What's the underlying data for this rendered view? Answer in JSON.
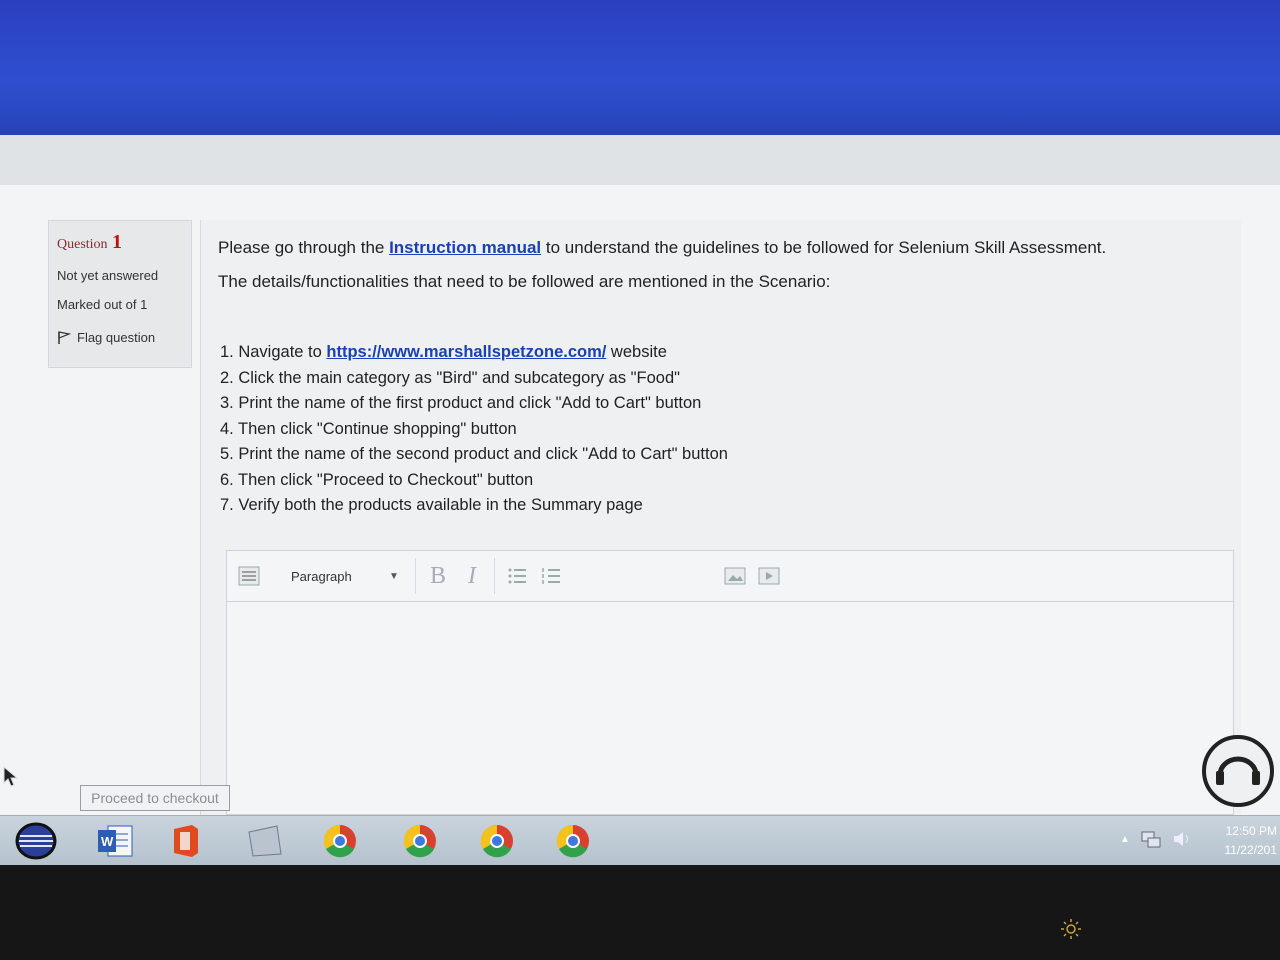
{
  "question": {
    "label": "Question",
    "number": "1",
    "status": "Not yet answered",
    "marks": "Marked out of 1",
    "flag_label": "Flag question"
  },
  "content": {
    "intro_before": "Please go through the ",
    "intro_link": "Instruction manual",
    "intro_after": " to understand the guidelines to be followed for Selenium Skill Assessment.",
    "details": "The details/functionalities that need to be followed are mentioned in the Scenario:",
    "step1_before": "1. Navigate to ",
    "step1_link": "https://www.marshallspetzone.com/",
    "step1_after": " website",
    "steps": [
      "2. Click the main category as \"Bird\" and subcategory as \"Food\"",
      "3. Print the name of the first product and click \"Add to Cart\" button",
      "4. Then click \"Continue shopping\" button",
      "5. Print the name of the second product and click \"Add to Cart\" button",
      "6. Then click \"Proceed to Checkout\" button",
      "7. Verify both the products available in the Summary page"
    ]
  },
  "editor": {
    "format_label": "Paragraph",
    "bold_label": "B",
    "italic_label": "I"
  },
  "checkout_label": "Proceed to checkout",
  "taskbar": {
    "word_label": "W",
    "time": "12:50 PM",
    "date": "11/22/201"
  },
  "colors": {
    "link": "#1b3fb5",
    "question_number": "#b11111",
    "desktop_blue": "#2f4fd0"
  }
}
